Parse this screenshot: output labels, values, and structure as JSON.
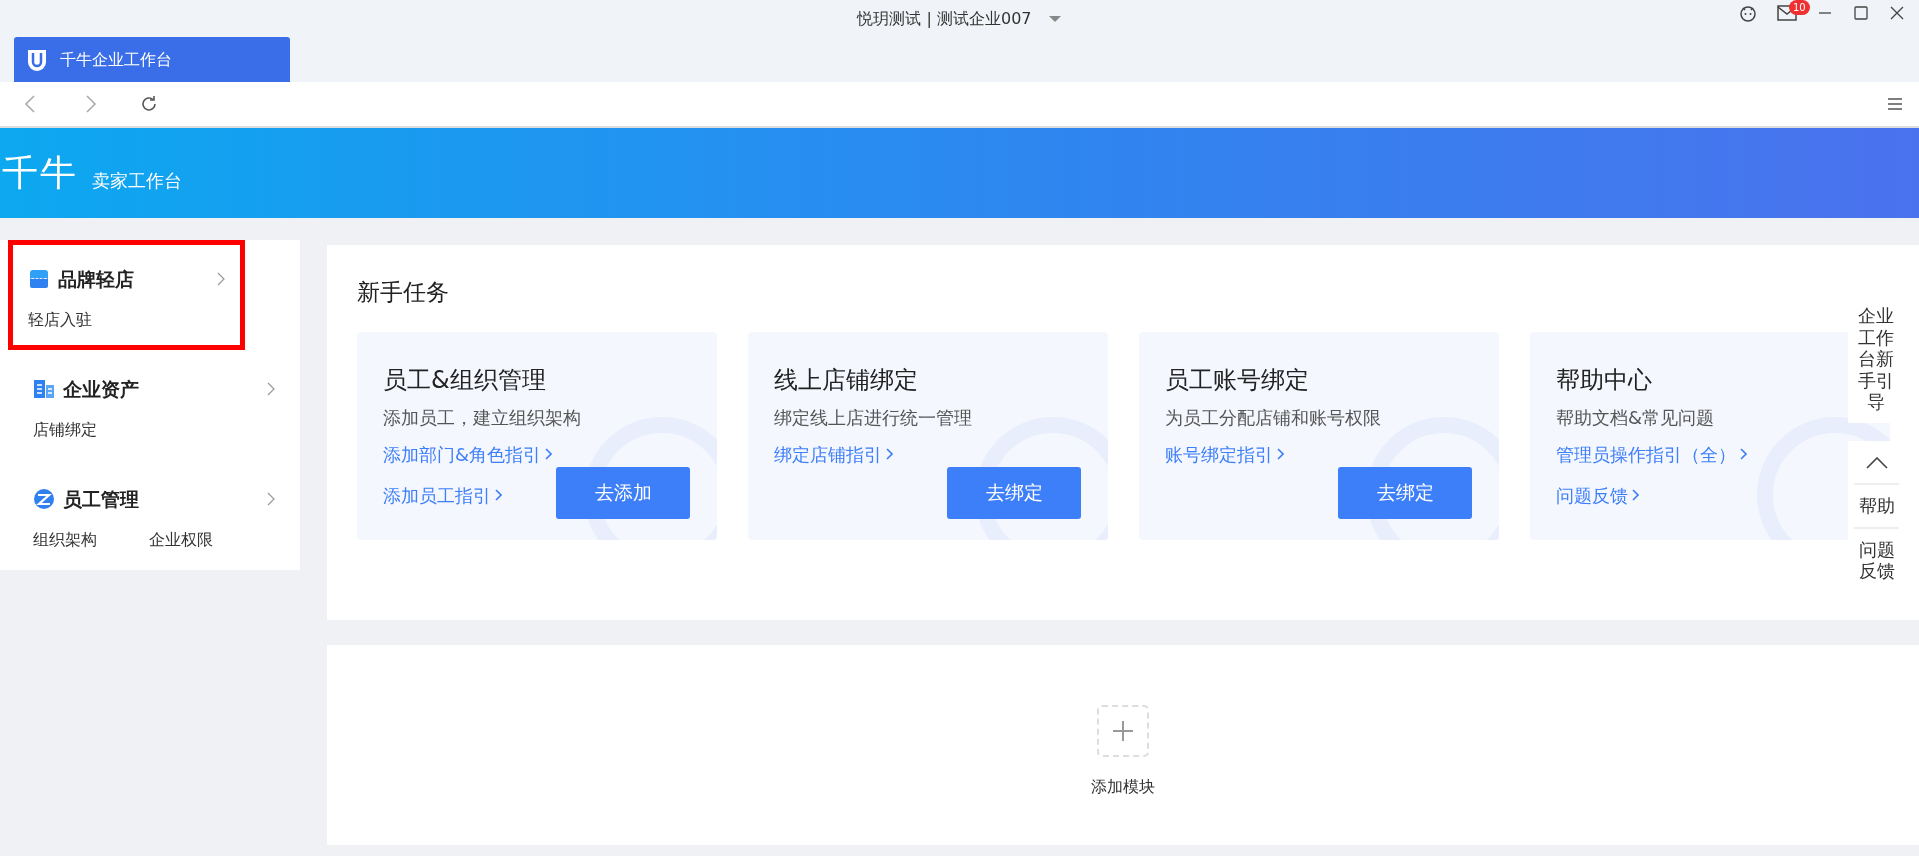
{
  "window": {
    "title": "悦玥测试 | 测试企业007",
    "mail_count": "10"
  },
  "tabs": [
    {
      "label": "千牛企业工作台",
      "selected": true
    }
  ],
  "header": {
    "logo": "千牛",
    "subtitle": "卖家工作台"
  },
  "sidebar": {
    "items": [
      {
        "title": "品牌轻店",
        "highlighted": true,
        "links": [
          "轻店入驻"
        ]
      },
      {
        "title": "企业资产",
        "highlighted": false,
        "links": [
          "店铺绑定"
        ]
      },
      {
        "title": "员工管理",
        "highlighted": false,
        "links": [
          "组织架构",
          "企业权限"
        ]
      }
    ]
  },
  "tasks": {
    "title": "新手任务",
    "cards": [
      {
        "title": "员工&组织管理",
        "desc": "添加员工，建立组织架构",
        "links": [
          "添加部门&角色指引",
          "添加员工指引"
        ],
        "button": "去添加"
      },
      {
        "title": "线上店铺绑定",
        "desc": "绑定线上店进行统一管理",
        "links": [
          "绑定店铺指引"
        ],
        "button": "去绑定"
      },
      {
        "title": "员工账号绑定",
        "desc": "为员工分配店铺和账号权限",
        "links": [
          "账号绑定指引"
        ],
        "button": "去绑定"
      },
      {
        "title": "帮助中心",
        "desc": "帮助文档&常见问题",
        "links": [
          "管理员操作指引（全）",
          "问题反馈"
        ]
      }
    ]
  },
  "modules": {
    "add_label": "添加模块"
  },
  "float_panel": {
    "guide": "企业工作台新手引导",
    "items": [
      "帮助",
      "问题反馈"
    ]
  }
}
